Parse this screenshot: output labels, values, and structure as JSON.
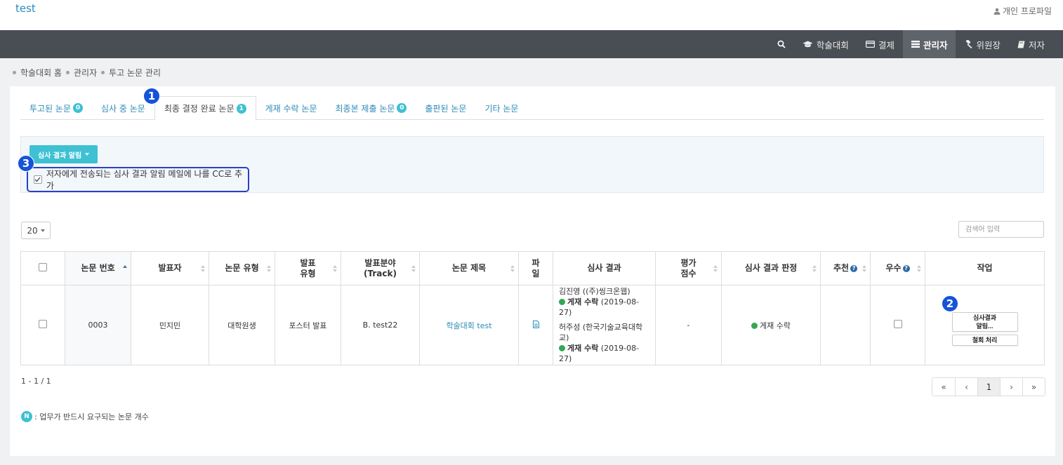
{
  "site": {
    "title": "test",
    "profile_label": "개인 프로파일"
  },
  "nav": {
    "items": [
      {
        "label": ""
      },
      {
        "label": "학술대회"
      },
      {
        "label": "결제"
      },
      {
        "label": "관리자"
      },
      {
        "label": "위원장"
      },
      {
        "label": "저자"
      }
    ],
    "active_index": 3
  },
  "breadcrumb": [
    "학술대회 홈",
    "관리자",
    "투고 논문 관리"
  ],
  "tabs": [
    {
      "label": "투고된 논문",
      "badge": "0"
    },
    {
      "label": "심사 중 논문",
      "badge": ""
    },
    {
      "label": "최종 결정 완료 논문",
      "badge": "1"
    },
    {
      "label": "게재 수락 논문",
      "badge": ""
    },
    {
      "label": "최종본 제출 논문",
      "badge": "0"
    },
    {
      "label": "출판된 논문",
      "badge": ""
    },
    {
      "label": "기타 논문",
      "badge": ""
    }
  ],
  "markers": [
    "1",
    "2",
    "3"
  ],
  "notify": {
    "button_label": "심사 결과 알림",
    "cc_label": "저자에게 전송되는 심사 결과 알림 메일에 나를 CC로 추가",
    "cc_checked": true
  },
  "list": {
    "page_size": "20",
    "search_placeholder": "검색어 입력"
  },
  "table": {
    "headers": {
      "paper_no": "논문 번호",
      "presenter": "발표자",
      "paper_type": "논문 유형",
      "pres_type_1": "발표",
      "pres_type_2": "유형",
      "track_1": "발표분야",
      "track_2": "(Track)",
      "title": "논문 제목",
      "file_1": "파",
      "file_2": "일",
      "review": "심사 결과",
      "score_1": "평가",
      "score_2": "점수",
      "decision": "심사 결과 판정",
      "recommend": "추천",
      "excellent": "우수",
      "action": "작업"
    },
    "rows": [
      {
        "paper_no": "0003",
        "presenter": "민지민",
        "paper_type": "대학원생",
        "pres_type": "포스터 발표",
        "track": "B. test22",
        "title": "학술대회 test",
        "reviews": [
          {
            "reviewer": "김진영 ((주)씽크온웹)",
            "result": "게재 수락",
            "date": "(2019-08-27)"
          },
          {
            "reviewer_line1": "허주성 (한국기술교육대학",
            "reviewer_line2": "교)",
            "result": "게재 수락",
            "date": "(2019-08-27)"
          }
        ],
        "score": "-",
        "decision": "게재 수락",
        "action_notify_1": "심사결과",
        "action_notify_2": "알림...",
        "action_withdraw": "철회 처리"
      }
    ]
  },
  "pagination": {
    "range": "1 - 1 / 1",
    "first": "«",
    "prev": "‹",
    "current": "1",
    "next": "›",
    "last": "»"
  },
  "legend": {
    "badge": "N",
    "text": ": 업무가 반드시 요구되는 논문 개수"
  },
  "colors": {
    "accent": "#3ec1d3",
    "link": "#2a8ab8",
    "navbar": "#494e55",
    "marker": "#1553d8",
    "success": "#34a853"
  }
}
